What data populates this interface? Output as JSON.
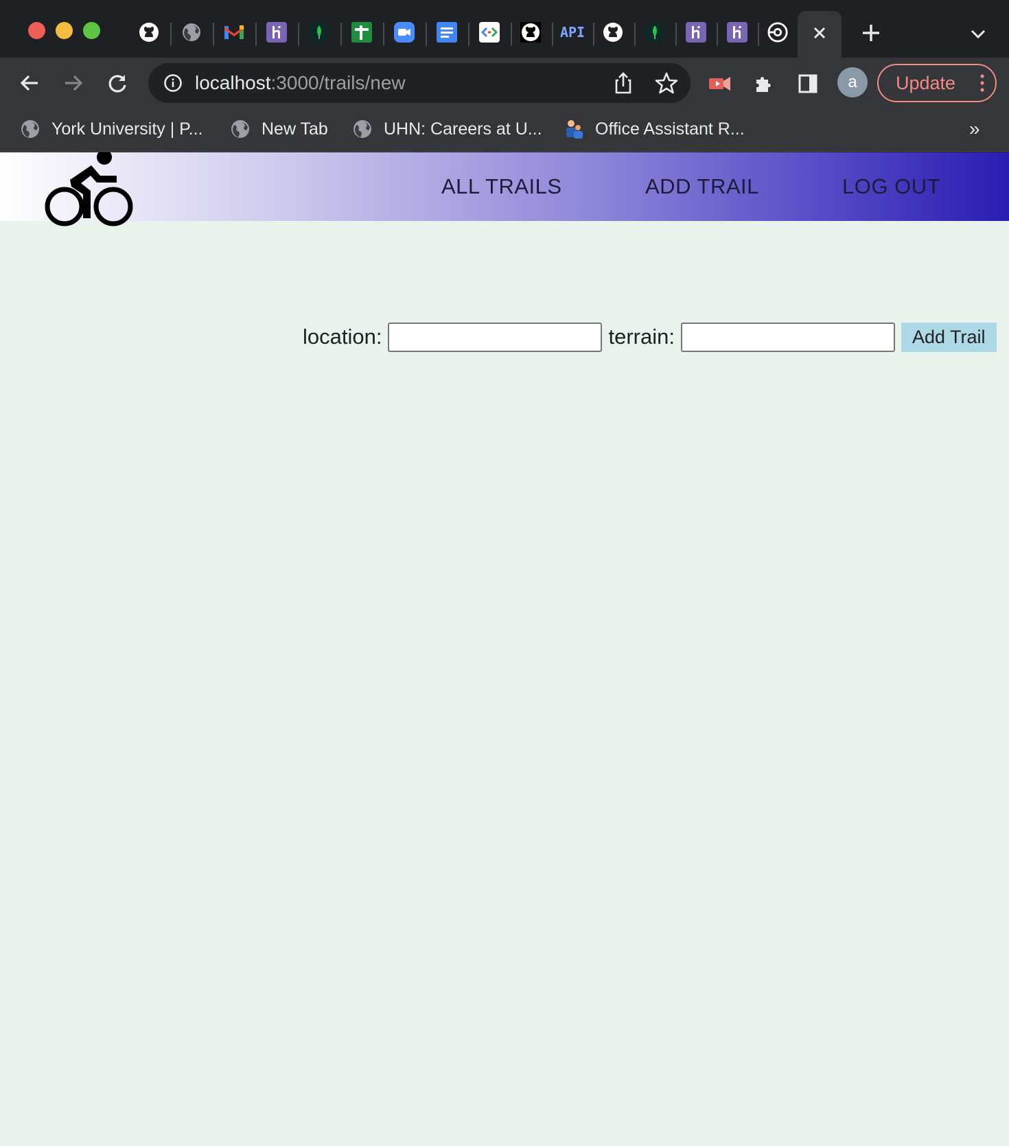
{
  "browser": {
    "tabs": [
      {
        "icon": "github-icon"
      },
      {
        "icon": "globe-icon"
      },
      {
        "icon": "gmail-icon"
      },
      {
        "icon": "heroku-icon"
      },
      {
        "icon": "mongodb-leaf-icon"
      },
      {
        "icon": "sheets-plus-icon"
      },
      {
        "icon": "zoom-camera-icon"
      },
      {
        "icon": "docs-icon"
      },
      {
        "icon": "code-brackets-icon"
      },
      {
        "icon": "github-icon"
      },
      {
        "icon": "api-icon",
        "text": "API"
      },
      {
        "icon": "github-icon"
      },
      {
        "icon": "mongodb-leaf-icon"
      },
      {
        "icon": "heroku-icon"
      },
      {
        "icon": "heroku-icon"
      },
      {
        "icon": "target-icon"
      }
    ],
    "url": {
      "host": "localhost",
      "path": ":3000/trails/new"
    },
    "avatar_letter": "a",
    "update_label": "Update",
    "bookmarks": [
      {
        "label": "York University | P...",
        "icon": "globe-icon"
      },
      {
        "label": "New Tab",
        "icon": "globe-icon"
      },
      {
        "label": "UHN: Careers at U...",
        "icon": "globe-icon"
      },
      {
        "label": "Office Assistant R...",
        "icon": "people-icon"
      }
    ],
    "bookmarks_more": "»"
  },
  "app": {
    "logo": "bicycle-icon",
    "nav": {
      "all_trails": "ALL TRAILS",
      "add_trail": "ADD TRAIL",
      "log_out": "LOG OUT"
    },
    "form": {
      "location_label": "location:",
      "location_value": "",
      "terrain_label": "terrain:",
      "terrain_value": "",
      "submit_label": "Add Trail"
    }
  },
  "colors": {
    "page_background": "#e9f3ec",
    "navbar_gradient_start": "#ffffff",
    "navbar_gradient_end": "#2a1cb2",
    "button_background": "#add8e6",
    "update_accent": "#f28b82"
  }
}
